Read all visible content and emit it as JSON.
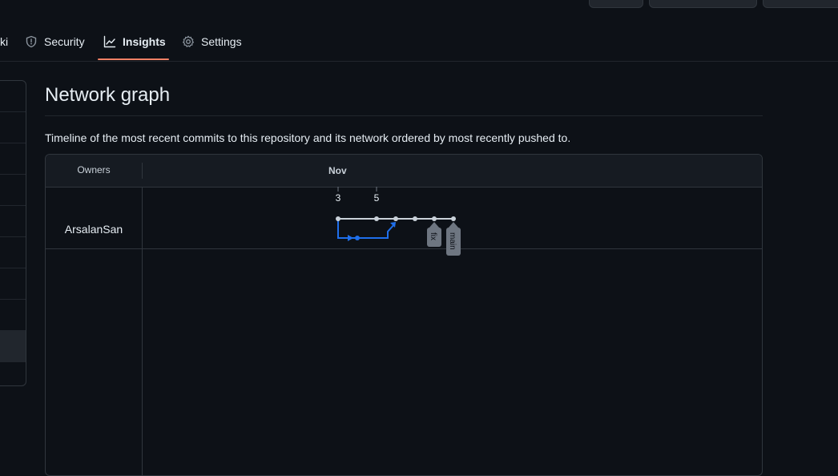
{
  "tabs": [
    {
      "label": "ki"
    },
    {
      "label": "Security"
    },
    {
      "label": "Insights"
    },
    {
      "label": "Settings"
    }
  ],
  "page": {
    "title": "Network graph",
    "description": "Timeline of the most recent commits to this repository and its network ordered by most recently pushed to."
  },
  "graph": {
    "owners_header": "Owners",
    "month": "Nov",
    "owner": "ArsalanSan",
    "day_labels": [
      "3",
      "5"
    ],
    "branch_labels": [
      "fix",
      "main"
    ]
  },
  "colors": {
    "accent_underline": "#f78166",
    "branch_line": "#1f6feb",
    "main_line": "#c9d1d9"
  }
}
